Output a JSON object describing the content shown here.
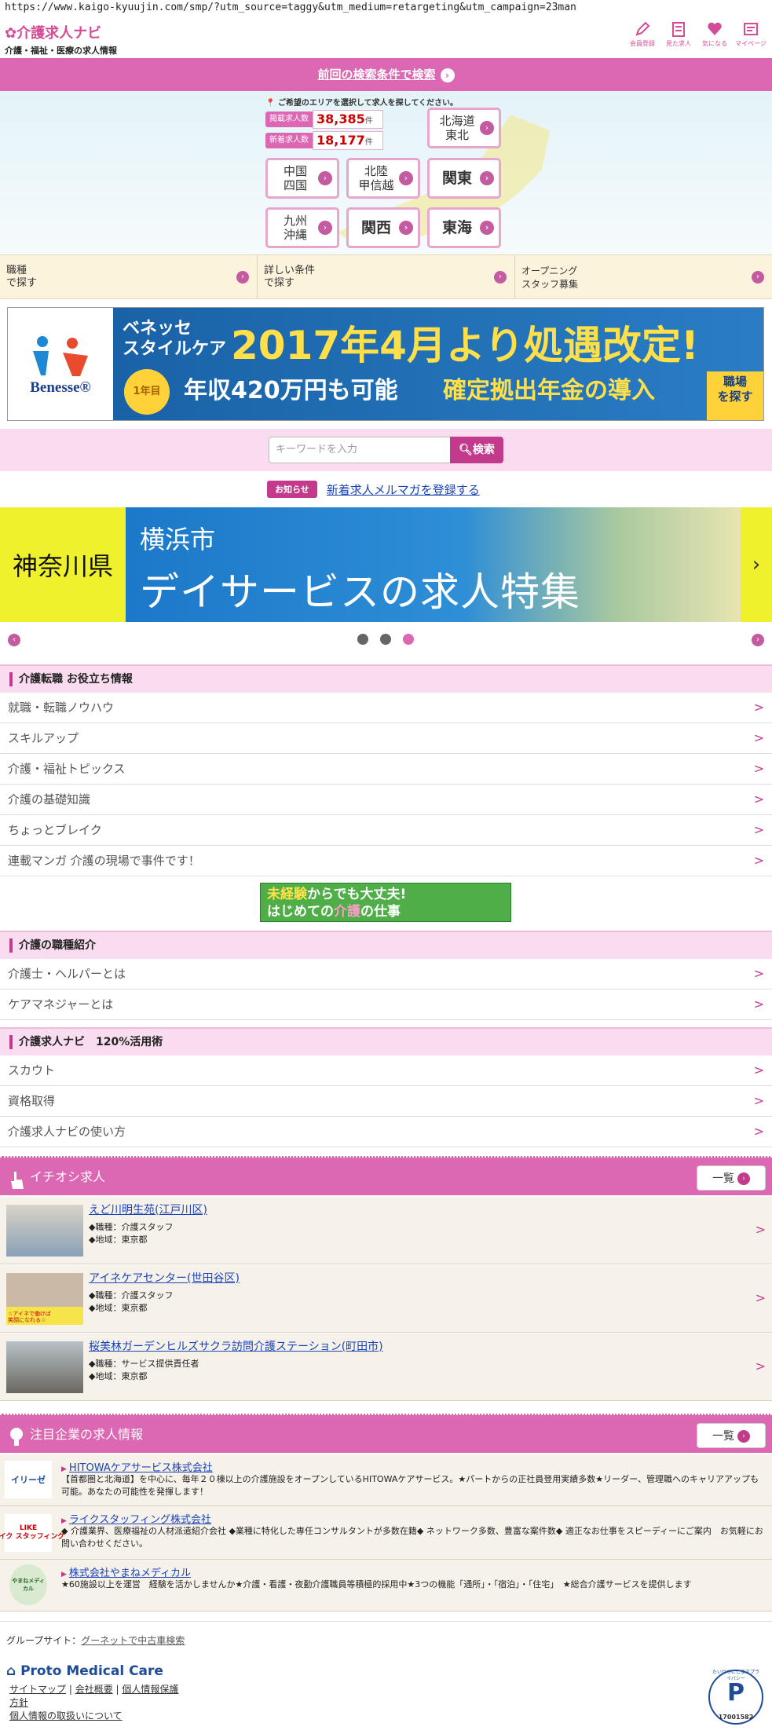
{
  "browser": {
    "url": "https://www.kaigo-kyuujin.com/smp/?utm_source=taggy&utm_medium=retargeting&utm_campaign=23man"
  },
  "header": {
    "logo_title": "介護求人ナビ",
    "logo_sub": "介護・福祉・医療の求人情報",
    "icons": [
      {
        "label": "会員登録",
        "icon": "pencil-icon"
      },
      {
        "label": "見た求人",
        "icon": "history-icon"
      },
      {
        "label": "気になる",
        "icon": "heart-icon"
      },
      {
        "label": "マイページ",
        "icon": "mypage-icon"
      }
    ]
  },
  "prev_search": {
    "label": "前回の検索条件で検索",
    "arrow": "›"
  },
  "map": {
    "hint": "ご希望のエリアを選択して求人を探してください。",
    "stats": [
      {
        "label": "掲載求人数",
        "value": "38,385",
        "unit": "件"
      },
      {
        "label": "新着求人数",
        "value": "18,177",
        "unit": "件"
      }
    ],
    "areas": {
      "hokkaido": "北海道\n東北",
      "chugoku": "中国\n四国",
      "hokuriku": "北陸\n甲信越",
      "kanto": "関東",
      "kyushu": "九州\n沖縄",
      "kansai": "関西",
      "tokai": "東海"
    }
  },
  "search_tabs": [
    {
      "label": "職種\nで探す"
    },
    {
      "label": "詳しい条件\nで探す"
    },
    {
      "label": "オープニング\nスタッフ募集"
    }
  ],
  "benesse_banner": {
    "logo": "Benesse®",
    "line1": "ベネッセ\nスタイルケア",
    "headline": "2017年4月より処遇改定!",
    "badge": "1年目",
    "salary": "年収420万円も可能",
    "pension": "確定拠出年金の導入",
    "cta": "職場\nを探す"
  },
  "search": {
    "placeholder": "キーワードを入力",
    "button": "検索"
  },
  "news": {
    "tag": "お知らせ",
    "link": "新着求人メルマガを登録する"
  },
  "feature_banner": {
    "pref": "神奈川県",
    "city": "横浜市",
    "title": "デイサービスの求人特集"
  },
  "sections": {
    "tips": {
      "title": "介護転職 お役立ち情報",
      "items": [
        "就職・転職ノウハウ",
        "スキルアップ",
        "介護・福祉トピックス",
        "介護の基礎知識",
        "ちょっとブレイク",
        "連載マンガ 介護の現場で事件です！"
      ]
    },
    "mikeiken": {
      "l1a": "未経験",
      "l1b": "からでも大丈夫!",
      "l2a": "はじめての",
      "l2b": "介護",
      "l2c": "の仕事"
    },
    "jobs": {
      "title": "介護の職種紹介",
      "items": [
        "介護士・ヘルパーとは",
        "ケアマネジャーとは"
      ]
    },
    "use": {
      "title": "介護求人ナビ　120%活用術",
      "items": [
        "スカウト",
        "資格取得",
        "介護求人ナビの使い方"
      ]
    }
  },
  "pickup": {
    "title": "イチオシ求人",
    "more": "一覧",
    "items": [
      {
        "name": "えど川明生苑(江戸川区)",
        "job": "◆職種：介護スタッフ",
        "area": "◆地域：東京都"
      },
      {
        "name": "アイネケアセンター(世田谷区)",
        "job": "◆職種：介護スタッフ",
        "area": "◆地域：東京都",
        "thumb_text": "☆アイネで働けば\n笑顔になれる☆"
      },
      {
        "name": "桜美林ガーデンヒルズサクラ訪問介護ステーション(町田市)",
        "job": "◆職種：サービス提供責任者",
        "area": "◆地域：東京都"
      }
    ]
  },
  "companies": {
    "title": "注目企業の求人情報",
    "more": "一覧",
    "items": [
      {
        "name": "HITOWAケアサービス株式会社",
        "logo": "イリーゼ",
        "desc": "【首都圏と北海道】を中心に、毎年２０棟以上の介護施設をオープンしているHITOWAケアサービス。★パートからの正社員登用実績多数★リーダー、管理職へのキャリアアップも可能。あなたの可能性を発揮します！"
      },
      {
        "name": "ライクスタッフィング株式会社",
        "logo": "LIKE\nライク スタッフィング",
        "desc": "◆ 介護業界、医療福祉の人材派遣紹介会社 ◆業種に特化した専任コンサルタントが多数在籍◆ ネットワーク多数、豊富な案件数◆ 適正なお仕事をスピーディーにご案内　お気軽にお問い合わせください。"
      },
      {
        "name": "株式会社やまねメディカル",
        "logo": "やまねメディカル",
        "desc": "★60施設以上を運営　経験を活かしませんか★介護・看護・夜勤介護職員等積極的採用中★3つの機能「通所」・「宿泊」・「住宅」　★総合介護サービスを提供します"
      }
    ]
  },
  "footer": {
    "group_label": "グループサイト：",
    "group_link": "グーネットで中古車検索",
    "brand": "Proto Medical Care",
    "links": [
      "サイトマップ",
      "会社概要",
      "個人情報保護",
      "方針",
      "個人情報の取扱いについて"
    ],
    "privacy_mark": "P",
    "privacy_no": "17001582",
    "privacy_arc": "たいせつにしますプライバシー"
  },
  "colors": {
    "accent_pink": "#dc67b3",
    "deep_pink": "#c33a8d",
    "link_blue": "#1a44b8"
  }
}
